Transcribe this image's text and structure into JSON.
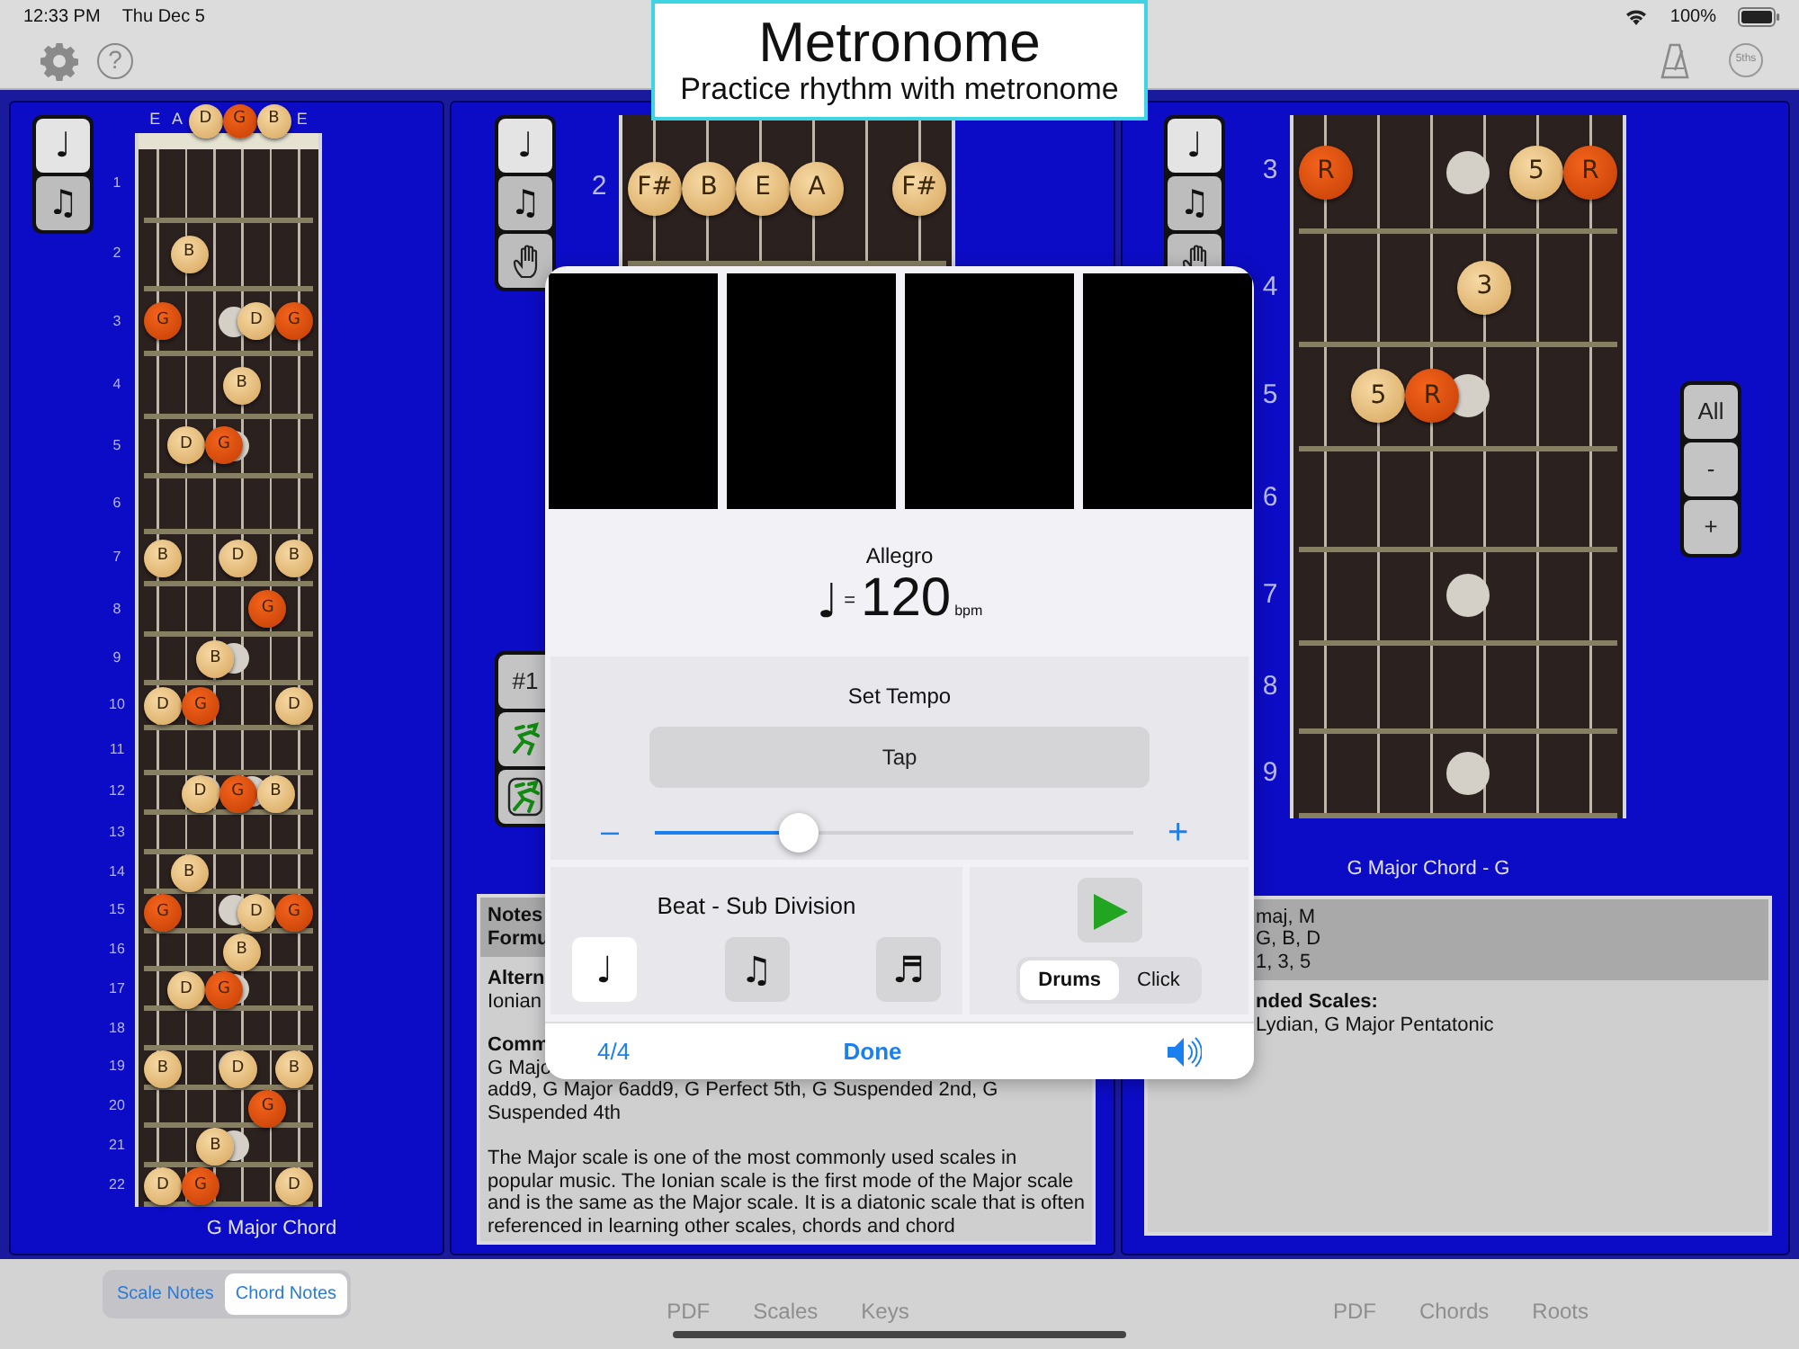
{
  "status_bar": {
    "time": "12:33 PM",
    "date": "Thu Dec 5",
    "battery": "100%"
  },
  "toolbar": {
    "help": "?",
    "fifths": "5ths"
  },
  "title_card": {
    "title": "Metronome",
    "subtitle": "Practice rhythm with metronome"
  },
  "scale_panel": {
    "mode_buttons": [
      {
        "glyph": "♩",
        "selected": true
      },
      {
        "glyph": "♫",
        "selected": false
      }
    ],
    "board": {
      "open_strings": [
        {
          "kind": "plain",
          "label": "E"
        },
        {
          "kind": "plain",
          "label": "A"
        },
        {
          "kind": "note",
          "label": "D"
        },
        {
          "kind": "root",
          "label": "G"
        },
        {
          "kind": "note",
          "label": "B"
        },
        {
          "kind": "plain",
          "label": "E"
        }
      ],
      "frets": [
        {
          "number": "1",
          "inlay": false,
          "strings": [
            {
              "kind": "empty"
            },
            {
              "kind": "empty"
            },
            {
              "kind": "empty"
            },
            {
              "kind": "empty"
            },
            {
              "kind": "empty"
            },
            {
              "kind": "empty"
            }
          ]
        },
        {
          "number": "2",
          "inlay": false,
          "strings": [
            {
              "kind": "empty"
            },
            {
              "kind": "note",
              "label": "B"
            },
            {
              "kind": "empty"
            },
            {
              "kind": "empty"
            },
            {
              "kind": "empty"
            },
            {
              "kind": "empty"
            }
          ]
        },
        {
          "number": "3",
          "inlay": true,
          "strings": [
            {
              "kind": "root",
              "label": "G"
            },
            {
              "kind": "empty"
            },
            {
              "kind": "empty"
            },
            {
              "kind": "empty"
            },
            {
              "kind": "note",
              "label": "D"
            },
            {
              "kind": "root",
              "label": "G"
            }
          ]
        },
        {
          "number": "4",
          "inlay": false,
          "strings": [
            {
              "kind": "empty"
            },
            {
              "kind": "empty"
            },
            {
              "kind": "empty"
            },
            {
              "kind": "note",
              "label": "B"
            },
            {
              "kind": "empty"
            },
            {
              "kind": "empty"
            }
          ]
        },
        {
          "number": "5",
          "inlay": true,
          "strings": [
            {
              "kind": "empty"
            },
            {
              "kind": "note",
              "label": "D"
            },
            {
              "kind": "root",
              "label": "G"
            },
            {
              "kind": "empty"
            },
            {
              "kind": "empty"
            },
            {
              "kind": "empty"
            }
          ]
        },
        {
          "number": "6",
          "inlay": false,
          "strings": [
            {
              "kind": "empty"
            },
            {
              "kind": "empty"
            },
            {
              "kind": "empty"
            },
            {
              "kind": "empty"
            },
            {
              "kind": "empty"
            },
            {
              "kind": "empty"
            }
          ]
        },
        {
          "number": "7",
          "inlay": true,
          "strings": [
            {
              "kind": "note",
              "label": "B"
            },
            {
              "kind": "empty"
            },
            {
              "kind": "empty"
            },
            {
              "kind": "note",
              "label": "D"
            },
            {
              "kind": "empty"
            },
            {
              "kind": "note",
              "label": "B"
            }
          ]
        },
        {
          "number": "8",
          "inlay": false,
          "strings": [
            {
              "kind": "empty"
            },
            {
              "kind": "empty"
            },
            {
              "kind": "empty"
            },
            {
              "kind": "empty"
            },
            {
              "kind": "root",
              "label": "G"
            },
            {
              "kind": "empty"
            }
          ]
        },
        {
          "number": "9",
          "inlay": true,
          "strings": [
            {
              "kind": "empty"
            },
            {
              "kind": "empty"
            },
            {
              "kind": "note",
              "label": "B"
            },
            {
              "kind": "empty"
            },
            {
              "kind": "empty"
            },
            {
              "kind": "empty"
            }
          ]
        },
        {
          "number": "10",
          "inlay": false,
          "strings": [
            {
              "kind": "note",
              "label": "D"
            },
            {
              "kind": "root",
              "label": "G"
            },
            {
              "kind": "empty"
            },
            {
              "kind": "empty"
            },
            {
              "kind": "empty"
            },
            {
              "kind": "note",
              "label": "D"
            }
          ]
        },
        {
          "number": "11",
          "inlay": false,
          "strings": [
            {
              "kind": "empty"
            },
            {
              "kind": "empty"
            },
            {
              "kind": "empty"
            },
            {
              "kind": "empty"
            },
            {
              "kind": "empty"
            },
            {
              "kind": "empty"
            }
          ]
        },
        {
          "number": "12",
          "inlay": true,
          "double_inlay": true,
          "strings": [
            {
              "kind": "empty"
            },
            {
              "kind": "empty"
            },
            {
              "kind": "note",
              "label": "D"
            },
            {
              "kind": "root",
              "label": "G"
            },
            {
              "kind": "note",
              "label": "B"
            },
            {
              "kind": "empty"
            }
          ]
        },
        {
          "number": "13",
          "inlay": false,
          "strings": [
            {
              "kind": "empty"
            },
            {
              "kind": "empty"
            },
            {
              "kind": "empty"
            },
            {
              "kind": "empty"
            },
            {
              "kind": "empty"
            },
            {
              "kind": "empty"
            }
          ]
        },
        {
          "number": "14",
          "inlay": false,
          "strings": [
            {
              "kind": "empty"
            },
            {
              "kind": "note",
              "label": "B"
            },
            {
              "kind": "empty"
            },
            {
              "kind": "empty"
            },
            {
              "kind": "empty"
            },
            {
              "kind": "empty"
            }
          ]
        },
        {
          "number": "15",
          "inlay": true,
          "strings": [
            {
              "kind": "root",
              "label": "G"
            },
            {
              "kind": "empty"
            },
            {
              "kind": "empty"
            },
            {
              "kind": "empty"
            },
            {
              "kind": "note",
              "label": "D"
            },
            {
              "kind": "root",
              "label": "G"
            }
          ]
        },
        {
          "number": "16",
          "inlay": false,
          "strings": [
            {
              "kind": "empty"
            },
            {
              "kind": "empty"
            },
            {
              "kind": "empty"
            },
            {
              "kind": "note",
              "label": "B"
            },
            {
              "kind": "empty"
            },
            {
              "kind": "empty"
            }
          ]
        },
        {
          "number": "17",
          "inlay": true,
          "strings": [
            {
              "kind": "empty"
            },
            {
              "kind": "note",
              "label": "D"
            },
            {
              "kind": "root",
              "label": "G"
            },
            {
              "kind": "empty"
            },
            {
              "kind": "empty"
            },
            {
              "kind": "empty"
            }
          ]
        },
        {
          "number": "18",
          "inlay": false,
          "strings": [
            {
              "kind": "empty"
            },
            {
              "kind": "empty"
            },
            {
              "kind": "empty"
            },
            {
              "kind": "empty"
            },
            {
              "kind": "empty"
            },
            {
              "kind": "empty"
            }
          ]
        },
        {
          "number": "19",
          "inlay": true,
          "strings": [
            {
              "kind": "note",
              "label": "B"
            },
            {
              "kind": "empty"
            },
            {
              "kind": "empty"
            },
            {
              "kind": "note",
              "label": "D"
            },
            {
              "kind": "empty"
            },
            {
              "kind": "note",
              "label": "B"
            }
          ]
        },
        {
          "number": "20",
          "inlay": false,
          "strings": [
            {
              "kind": "empty"
            },
            {
              "kind": "empty"
            },
            {
              "kind": "empty"
            },
            {
              "kind": "empty"
            },
            {
              "kind": "root",
              "label": "G"
            },
            {
              "kind": "empty"
            }
          ]
        },
        {
          "number": "21",
          "inlay": true,
          "strings": [
            {
              "kind": "empty"
            },
            {
              "kind": "empty"
            },
            {
              "kind": "note",
              "label": "B"
            },
            {
              "kind": "empty"
            },
            {
              "kind": "empty"
            },
            {
              "kind": "empty"
            }
          ]
        },
        {
          "number": "22",
          "inlay": false,
          "strings": [
            {
              "kind": "note",
              "label": "D"
            },
            {
              "kind": "root",
              "label": "G"
            },
            {
              "kind": "empty"
            },
            {
              "kind": "empty"
            },
            {
              "kind": "empty"
            },
            {
              "kind": "note",
              "label": "D"
            }
          ]
        }
      ]
    },
    "caption": "G Major Chord"
  },
  "scale_info_panel": {
    "mode_buttons": [
      {
        "kind": "glyph",
        "glyph": "♩",
        "selected": true
      },
      {
        "kind": "glyph",
        "glyph": "♫",
        "selected": false
      },
      {
        "kind": "hand",
        "selected": false
      }
    ],
    "board": {
      "frets": [
        {
          "number": "2",
          "inlay": false,
          "strings": [
            {
              "kind": "note",
              "label": "F#"
            },
            {
              "kind": "note",
              "label": "B"
            },
            {
              "kind": "note",
              "label": "E"
            },
            {
              "kind": "note",
              "label": "A"
            },
            {
              "kind": "empty"
            },
            {
              "kind": "note",
              "label": "F#"
            }
          ]
        }
      ]
    },
    "tool_buttons": [
      {
        "kind": "text",
        "label": "#1"
      },
      {
        "kind": "figure"
      },
      {
        "kind": "figure_framed"
      }
    ],
    "info": {
      "header": [
        {
          "bold": true,
          "text": "Notes"
        },
        {
          "bold": true,
          "text": "Formu"
        }
      ],
      "body": [
        {
          "kind": "heading",
          "text": "Altern"
        },
        {
          "kind": "text",
          "text": "Ionian"
        },
        {
          "kind": "heading",
          "text": "Comm"
        },
        {
          "kind": "text",
          "text": "G Majo"
        },
        {
          "kind": "text",
          "text": "add9, G Major 6add9, G Perfect 5th, G Suspended 2nd, G Suspended 4th"
        },
        {
          "kind": "paragraph",
          "text": "The Major scale is one of the most commonly used scales in popular music. The Ionian scale is the first mode of the Major scale and is the same as the Major scale. It is a diatonic scale that is often referenced in learning other scales, chords and chord"
        }
      ]
    }
  },
  "chord_panel": {
    "mode_buttons": [
      {
        "kind": "glyph",
        "glyph": "♩",
        "selected": true
      },
      {
        "kind": "glyph",
        "glyph": "♫",
        "selected": false
      },
      {
        "kind": "hand",
        "selected": false
      }
    ],
    "board": {
      "frets": [
        {
          "number": "3",
          "inlay": true,
          "strings": [
            {
              "kind": "root",
              "label": "R"
            },
            {
              "kind": "empty"
            },
            {
              "kind": "empty"
            },
            {
              "kind": "empty"
            },
            {
              "kind": "note",
              "label": "5"
            },
            {
              "kind": "root",
              "label": "R"
            }
          ]
        },
        {
          "number": "4",
          "inlay": false,
          "strings": [
            {
              "kind": "empty"
            },
            {
              "kind": "empty"
            },
            {
              "kind": "empty"
            },
            {
              "kind": "note",
              "label": "3"
            },
            {
              "kind": "empty"
            },
            {
              "kind": "empty"
            }
          ]
        },
        {
          "number": "5",
          "inlay": true,
          "strings": [
            {
              "kind": "empty"
            },
            {
              "kind": "note",
              "label": "5"
            },
            {
              "kind": "root",
              "label": "R"
            },
            {
              "kind": "empty"
            },
            {
              "kind": "empty"
            },
            {
              "kind": "empty"
            }
          ]
        },
        {
          "number": "6",
          "inlay": false,
          "strings": [
            {
              "kind": "empty"
            },
            {
              "kind": "empty"
            },
            {
              "kind": "empty"
            },
            {
              "kind": "empty"
            },
            {
              "kind": "empty"
            },
            {
              "kind": "empty"
            }
          ]
        },
        {
          "number": "7",
          "inlay": true,
          "strings": [
            {
              "kind": "empty"
            },
            {
              "kind": "empty"
            },
            {
              "kind": "empty"
            },
            {
              "kind": "empty"
            },
            {
              "kind": "empty"
            },
            {
              "kind": "empty"
            }
          ]
        },
        {
          "number": "8",
          "inlay": false,
          "strings": [
            {
              "kind": "empty"
            },
            {
              "kind": "empty"
            },
            {
              "kind": "empty"
            },
            {
              "kind": "empty"
            },
            {
              "kind": "empty"
            },
            {
              "kind": "empty"
            }
          ]
        },
        {
          "number": "9",
          "inlay": true,
          "strings": [
            {
              "kind": "empty"
            },
            {
              "kind": "empty"
            },
            {
              "kind": "empty"
            },
            {
              "kind": "empty"
            },
            {
              "kind": "empty"
            },
            {
              "kind": "empty"
            }
          ]
        }
      ]
    },
    "zoom_buttons": [
      "All",
      "-",
      "+"
    ],
    "caption": "G Major Chord - G",
    "info": {
      "header": [
        {
          "bold": false,
          "text": "maj, M"
        },
        {
          "bold": false,
          "text": "G, B, D"
        },
        {
          "bold": false,
          "text": "1, 3, 5"
        }
      ],
      "body": [
        {
          "kind": "heading",
          "text": "nded Scales:"
        },
        {
          "kind": "text",
          "text": "Lydian, G Major Pentatonic"
        }
      ]
    }
  },
  "metronome": {
    "beats": [
      {
        "lit": false
      },
      {
        "lit": false
      },
      {
        "lit": false
      },
      {
        "lit": false
      }
    ],
    "tempo_name": "Allegro",
    "note": "♩",
    "equals": "=",
    "bpm": "120",
    "unit": "bpm",
    "set_tempo": "Set Tempo",
    "tap": "Tap",
    "minus": "–",
    "plus": "+",
    "slider": {
      "level": 0.3
    },
    "subdivision_title": "Beat - Sub Division",
    "subdivisions": [
      {
        "glyph": "♩",
        "selected": true
      },
      {
        "glyph": "♫",
        "selected": false
      },
      {
        "glyph": "♬",
        "selected": false
      }
    ],
    "sounds": [
      {
        "label": "Drums",
        "selected": true
      },
      {
        "label": "Click",
        "selected": false
      }
    ],
    "time_signature": "4/4",
    "done": "Done"
  },
  "bottom_bar": {
    "note_modes": [
      {
        "label": "Scale Notes",
        "selected": false
      },
      {
        "label": "Chord Notes",
        "selected": true
      }
    ],
    "scale_links": [
      "PDF",
      "Scales",
      "Keys"
    ],
    "chord_links": [
      "PDF",
      "Chords",
      "Roots"
    ]
  }
}
